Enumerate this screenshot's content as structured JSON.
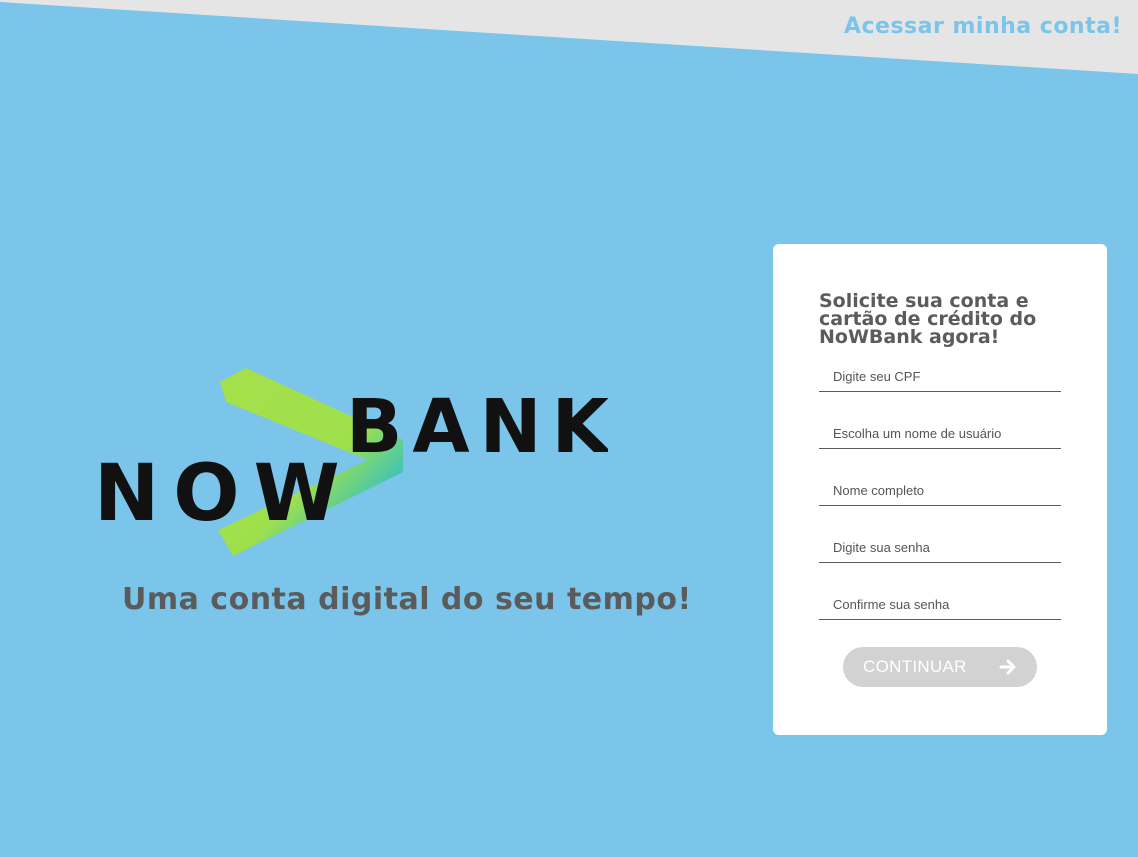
{
  "header": {
    "login_link": "Acessar minha conta!"
  },
  "hero": {
    "logo": {
      "word_left": "NOW",
      "word_right": "BANK"
    },
    "tagline": "Uma conta digital do seu tempo!"
  },
  "signup": {
    "title": "Solicite sua conta e cartão de crédito do NoWBank agora!",
    "fields": [
      {
        "placeholder": "Digite seu CPF",
        "value": ""
      },
      {
        "placeholder": "Escolha um nome de usuário",
        "value": ""
      },
      {
        "placeholder": "Nome completo",
        "value": ""
      },
      {
        "placeholder": "Digite sua senha",
        "value": ""
      },
      {
        "placeholder": "Confirme sua senha",
        "value": ""
      }
    ],
    "submit_label": "CONTINUAR"
  },
  "colors": {
    "background": "#7bc4ea",
    "header_band": "#e5e5e5",
    "card": "#ffffff",
    "text_dark": "#5b5b5b",
    "button": "#d2d2d2",
    "logo_green": "#a6e04a",
    "logo_teal": "#35c2c2"
  },
  "icons": {
    "submit": "arrow-right-icon"
  }
}
